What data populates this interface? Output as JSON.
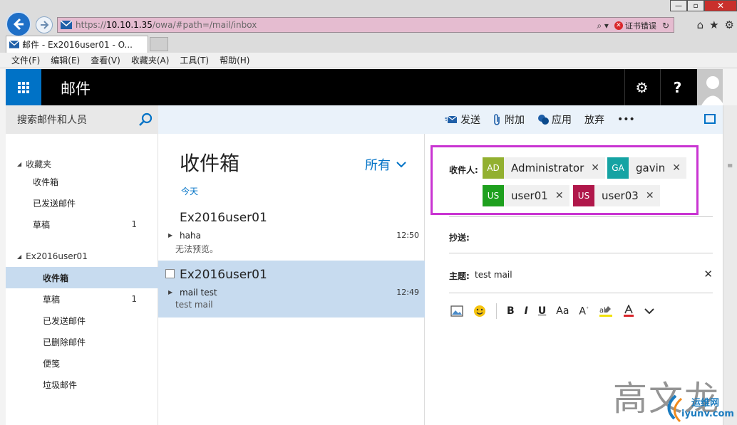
{
  "browser": {
    "window_min": "—",
    "window_max": "▫",
    "window_close": "✕",
    "url_prefix": "https://",
    "url_host": "10.10.1.35",
    "url_path": "/owa/#path=/mail/inbox",
    "cert_error": "证书错误",
    "tab_title": "邮件 - Ex2016user01 - O...",
    "menu": [
      "文件(F)",
      "编辑(E)",
      "查看(V)",
      "收藏夹(A)",
      "工具(T)",
      "帮助(H)"
    ]
  },
  "owa": {
    "app_title": "邮件",
    "help_label": "?"
  },
  "left_nav": {
    "search_placeholder": "搜索邮件和人员",
    "favorites_label": "收藏夹",
    "favorites": [
      {
        "label": "收件箱",
        "count": ""
      },
      {
        "label": "已发送邮件",
        "count": ""
      },
      {
        "label": "草稿",
        "count": "1"
      }
    ],
    "account_label": "Ex2016user01",
    "folders": [
      {
        "label": "收件箱",
        "count": "",
        "selected": true
      },
      {
        "label": "草稿",
        "count": "1"
      },
      {
        "label": "已发送邮件",
        "count": ""
      },
      {
        "label": "已删除邮件",
        "count": ""
      },
      {
        "label": "便笺",
        "count": ""
      },
      {
        "label": "垃圾邮件",
        "count": ""
      }
    ]
  },
  "message_list": {
    "title": "收件箱",
    "filter": "所有",
    "group_label": "今天",
    "messages": [
      {
        "from": "Ex2016user01",
        "subject": "haha",
        "time": "12:50",
        "preview": "无法预览。"
      },
      {
        "from": "Ex2016user01",
        "subject": "mail test",
        "time": "12:49",
        "preview": "test mail"
      }
    ]
  },
  "compose": {
    "commands": {
      "send": "发送",
      "attach": "附加",
      "apps": "应用",
      "discard": "放弃",
      "more": "•••"
    },
    "to_label": "收件人:",
    "recipients": [
      {
        "initials": "AD",
        "name": "Administrator",
        "color": "#92b030"
      },
      {
        "initials": "GA",
        "name": "gavin",
        "color": "#15a3a3"
      },
      {
        "initials": "US",
        "name": "user01",
        "color": "#1ea01e"
      },
      {
        "initials": "US",
        "name": "user03",
        "color": "#b0174a"
      }
    ],
    "cc_label": "抄送:",
    "subject_label": "主题:",
    "subject_value": "test mail",
    "format": {
      "bold": "B",
      "italic": "I",
      "underline": "U",
      "font_size": "Aa",
      "grow": "A"
    }
  },
  "watermark": {
    "text": "高文龙",
    "site": "iyunv.com",
    "brand": "运维网"
  },
  "colors": {
    "accent": "#0072c6",
    "header_bg": "#000000",
    "selection": "#c7dbef",
    "highlight_box": "#c934d2"
  }
}
